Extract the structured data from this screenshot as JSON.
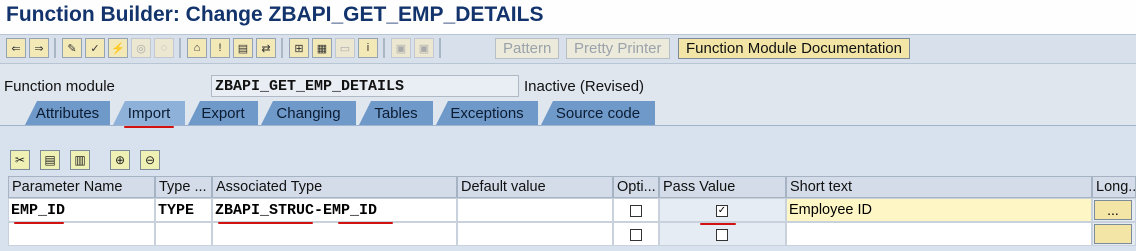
{
  "title": "Function Builder: Change ZBAPI_GET_EMP_DETAILS",
  "toolbar": {
    "icons": [
      "back-icon",
      "forward-icon",
      "other-object-icon",
      "check-icon",
      "activate-icon",
      "where-used-icon",
      "display-object-list-icon",
      "breakpoint-icon",
      "test-icon",
      "navigate-icon",
      "hierarchy-icon",
      "print-icon",
      "select-all-icon",
      "info-icon",
      "insert-icon",
      "replace-icon"
    ],
    "pattern": "Pattern",
    "pretty_printer": "Pretty Printer",
    "fm_doc": "Function Module Documentation"
  },
  "fm": {
    "label": "Function module",
    "value": "ZBAPI_GET_EMP_DETAILS",
    "status": "Inactive (Revised)"
  },
  "tabs": [
    "Attributes",
    "Import",
    "Export",
    "Changing",
    "Tables",
    "Exceptions",
    "Source code"
  ],
  "active_tab": "Import",
  "table_tools": [
    "cut-icon",
    "copy-icon",
    "paste-icon",
    "insert-row-icon",
    "delete-row-icon"
  ],
  "columns": [
    "Parameter Name",
    "Type ...",
    "Associated Type",
    "Default value",
    "Opti...",
    "Pass Value",
    "Short text",
    "Long..."
  ],
  "rows": [
    {
      "param": "EMP_ID",
      "type": "TYPE",
      "assoc": "ZBAPI_STRUC-EMP_ID",
      "default": "",
      "optional": false,
      "pass_value": true,
      "short_text": "Employee ID",
      "long_btn": "..."
    },
    {
      "param": "",
      "type": "",
      "assoc": "",
      "default": "",
      "optional": false,
      "pass_value": false,
      "short_text": "",
      "long_btn": ""
    }
  ],
  "annotation_color": "#d21111"
}
